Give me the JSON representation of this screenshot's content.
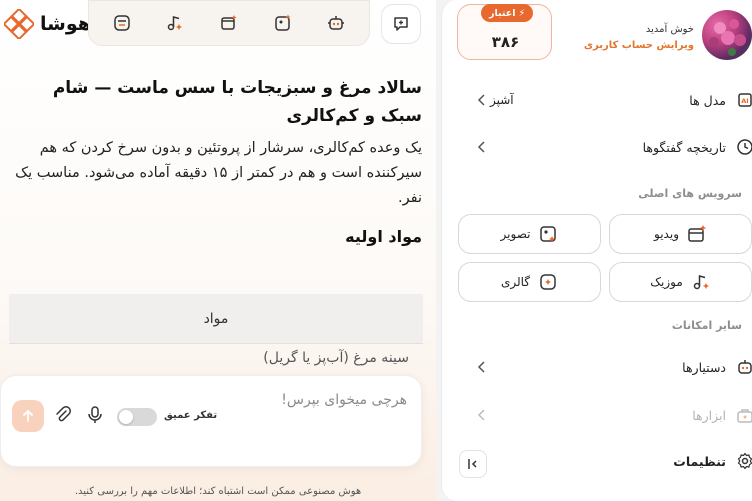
{
  "brand": {
    "name": "هوشا",
    "accent": "#e9682e"
  },
  "toolbar": {
    "tools": [
      "chat-bubble-icon",
      "robot-icon",
      "image-sparkle-icon",
      "video-sparkle-icon",
      "music-sparkle-icon",
      "gallery-icon"
    ]
  },
  "article": {
    "title": "سالاد مرغ و سبزیجات با سس ماست — شام سبک و کم‌کالری",
    "intro": "یک وعده کم‌کالری، سرشار از پروتئین و بدون سرخ کردن که هم سیرکننده است و هم در کمتر از ۱۵ دقیقه آماده می‌شود. مناسب یک نفر.",
    "ingredients_heading": "مواد اولیه",
    "table_header": "مواد",
    "table_first_row": "سینه مرغ (آب‌پز یا گریل)"
  },
  "composer": {
    "placeholder": "هرچی میخوای بپرس!",
    "deep_think_label": "تفکر عمیق",
    "deep_think_on": false
  },
  "disclaimer": "هوش مصنوعی ممکن است اشتباه کند؛ اطلاعات مهم را بررسی کنید.",
  "sidebar": {
    "welcome": "خوش آمدید",
    "edit_account": "ویرایش حساب کاربری",
    "credit_label": "اعتبار",
    "credit_value": "۳۸۶",
    "models_label": "مدل ها",
    "models_value": "آشپز",
    "history_label": "تاریخچه گفتگوها",
    "main_services_title": "سرویس های اصلی",
    "services": [
      {
        "label": "ویدیو",
        "icon": "video-icon"
      },
      {
        "label": "تصویر",
        "icon": "image-icon"
      },
      {
        "label": "موزیک",
        "icon": "music-icon"
      },
      {
        "label": "گالری",
        "icon": "gallery-icon"
      }
    ],
    "other_title": "سایر امکانات",
    "assistants_label": "دستیارها",
    "tools_label": "ابزارها",
    "settings_label": "تنظیمات"
  }
}
